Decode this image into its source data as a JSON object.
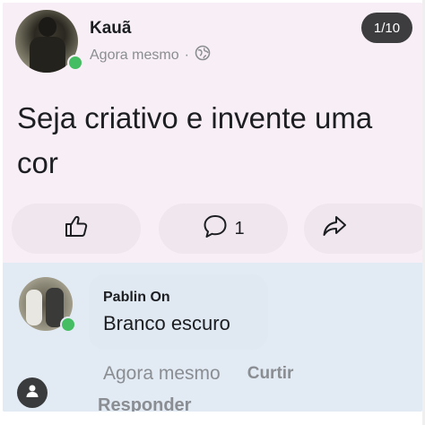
{
  "post": {
    "author": "Kauã",
    "time": "Agora mesmo",
    "privacy_icon": "globe-icon",
    "counter": "1/10",
    "text": "Seja criativo e invente uma cor",
    "actions": {
      "like_icon": "thumbs-up-icon",
      "comment_icon": "comment-icon",
      "comment_count": "1",
      "share_icon": "share-icon"
    }
  },
  "comment": {
    "author": "Pablin On",
    "text": "Branco escuro",
    "time": "Agora mesmo",
    "like_label": "Curtir",
    "reply_label": "Responder"
  },
  "colors": {
    "online": "#45bd62",
    "post_background": "#f8eff6",
    "comment_background": "#e2eaf4",
    "muted_text": "#8a8d91"
  }
}
